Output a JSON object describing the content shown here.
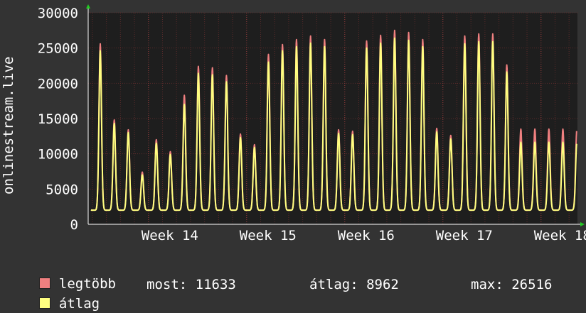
{
  "chart_data": {
    "type": "line",
    "ylabel": "onlinestream.live",
    "ylim": [
      0,
      30000
    ],
    "y_ticks": [
      "0",
      "5000",
      "10000",
      "15000",
      "20000",
      "25000",
      "30000"
    ],
    "x_ticks": [
      "Week 14",
      "Week 15",
      "Week 16",
      "Week 17",
      "Week 18"
    ],
    "x_range_days": [
      -4.3,
      30.6
    ],
    "grid": true,
    "legend_position": "bottom-left",
    "series": [
      {
        "name": "legtöbb",
        "color": "#f08080",
        "daily_peaks": [
          27000,
          25600,
          14800,
          13400,
          7400,
          12000,
          10300,
          18300,
          22400,
          22200,
          21100,
          12800,
          11300,
          24100,
          25500,
          26200,
          26700,
          26200,
          13400,
          13200,
          26000,
          26800,
          27500,
          27200,
          26200,
          13600,
          12600,
          26700,
          27000,
          27000,
          22600,
          13500
        ],
        "daily_min": 2000
      },
      {
        "name": "átlag",
        "color": "#ffff80",
        "daily_peaks": [
          26000,
          24600,
          14300,
          13000,
          7000,
          11500,
          9900,
          17000,
          21400,
          21200,
          20200,
          12300,
          10900,
          23000,
          24600,
          25200,
          25700,
          25200,
          12900,
          12700,
          25000,
          25700,
          26400,
          26100,
          25200,
          13100,
          12100,
          25600,
          25900,
          25900,
          21600,
          11633
        ],
        "daily_min": 2000
      }
    ]
  },
  "legend": {
    "items": [
      {
        "label": "legtöbb",
        "color": "#f08080"
      },
      {
        "label": "átlag",
        "color": "#ffff80"
      }
    ]
  },
  "stats": {
    "most_label": "most:",
    "most_value": "11633",
    "atlag_label": "átlag:",
    "atlag_value": "8962",
    "max_label": "max:",
    "max_value": "26516"
  },
  "colors": {
    "background": "#333333",
    "plot_background": "#1e1e1e",
    "grid": "#5a2a2a",
    "axis": "#ffffff",
    "arrow": "#22cc22"
  }
}
